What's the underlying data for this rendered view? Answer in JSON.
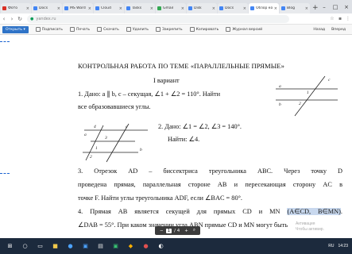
{
  "browser": {
    "tabs": [
      {
        "label": "Фото",
        "color": "#d93025"
      },
      {
        "label": "Docs",
        "color": "#4285f4"
      },
      {
        "label": "MS Word",
        "color": "#4285f4"
      },
      {
        "label": "Cloud",
        "color": "#4285f4"
      },
      {
        "label": "Tasks",
        "color": "#4285f4"
      },
      {
        "label": "Gmail",
        "color": "#34a853"
      },
      {
        "label": "Disk",
        "color": "#4285f4"
      },
      {
        "label": "Docs",
        "color": "#4285f4"
      },
      {
        "label": "Обзор кон",
        "color": "#4285f4",
        "active": true
      },
      {
        "label": "Blog",
        "color": "#4285f4"
      }
    ],
    "url": "yandex.ru"
  },
  "toolbar": {
    "open_label": "Открыть",
    "items": [
      "Подписать",
      "Печать",
      "Скачать",
      "Удалить",
      "Закрепить",
      "Копировать",
      "Журнал версий"
    ],
    "right": [
      "Назад",
      "Вперед"
    ]
  },
  "doc": {
    "title": "КОНТРОЛЬНАЯ РАБОТА ПО ТЕМЕ «ПАРАЛЛЕЛЬНЫЕ ПРЯМЫЕ»",
    "variant": "I вариант",
    "p1_line1": "1.    Дано: a ∥ b, c – секущая, ∠1 + ∠2 = 110°. Найти",
    "p1_line2": "все образовавшиеся углы.",
    "p2_line1": "2.    Дано: ∠1 = ∠2, ∠3 = 140°.",
    "p2_line2": "Найти: ∠4.",
    "p3_line1": "3.    Отрезок  AD  –  биссектриса  треугольника  ABC.  Через  точку  D",
    "p3_line2": "проведена прямая, параллельная стороне AB и пересекающая сторону AC в",
    "p3_line3": "точке  F. Найти углы треугольника ADF, если ∠BAC = 80°.",
    "p4_line1_pre": "4.    Прямая  AB  является  секущей  для  прямых  CD  и  MN  ",
    "p4_line1_hl": "(A∈CD, B∈MN)",
    "p4_line1_post": ".",
    "p4_line2": "∠DAB = 55°. При каком значении угла ABN прямые CD и  MN могут быть",
    "fig1_labels": [
      "c",
      "a",
      "b",
      "1",
      "2"
    ],
    "fig2_labels": [
      "4",
      "a",
      "3",
      "1",
      "2",
      "c",
      "b"
    ]
  },
  "zoom": {
    "page": "1",
    "total": "/ 4",
    "minus": "−",
    "plus": "+"
  },
  "watermark": {
    "line1": "Активация",
    "line2": "Чтобы активир."
  },
  "taskbar": {
    "tray": [
      "RU",
      "14:23"
    ]
  }
}
